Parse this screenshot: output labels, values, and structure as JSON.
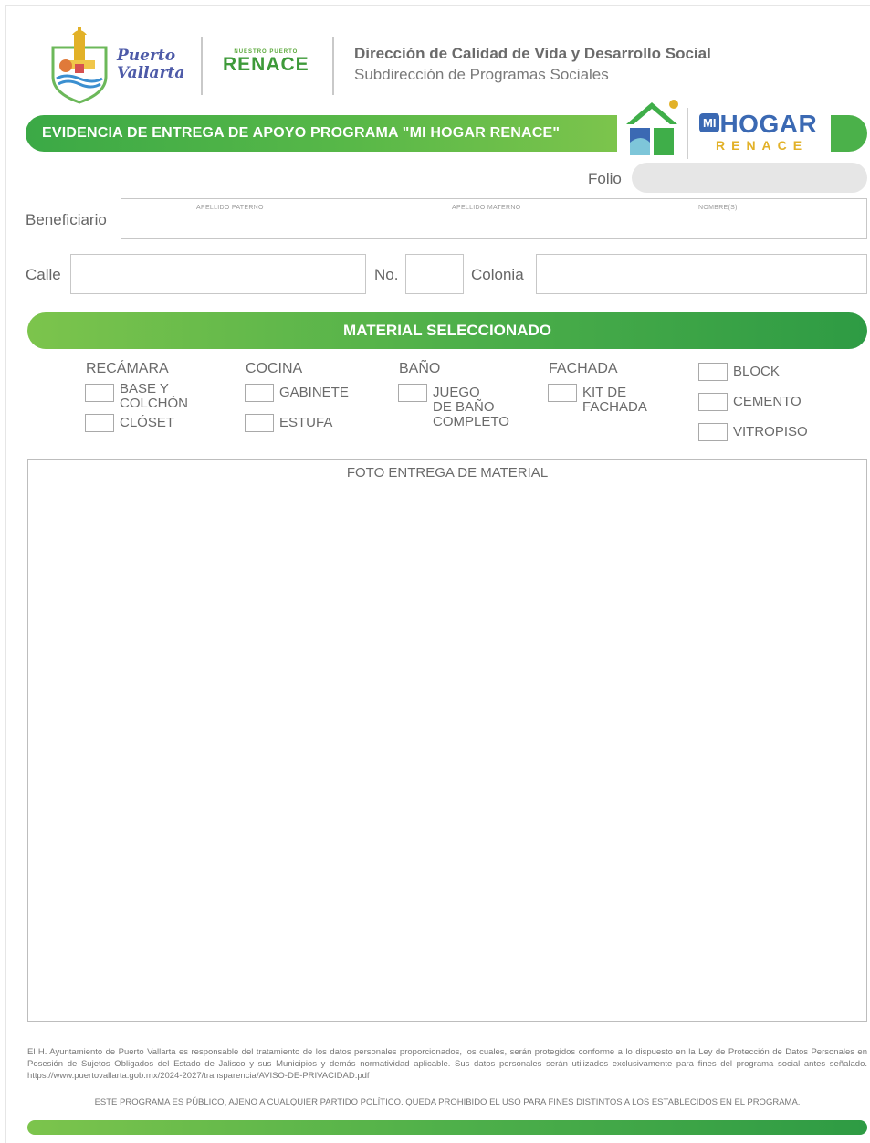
{
  "header": {
    "logo_text_line1": "Puerto",
    "logo_text_line2": "Vallarta",
    "renace_top": "NUESTRO PUERTO",
    "renace_main": "RENACE",
    "direction_title": "Dirección de Calidad de Vida y Desarrollo Social",
    "direction_subtitle": "Subdirección de Programas Sociales"
  },
  "banner": {
    "title": "EVIDENCIA DE ENTREGA DE APOYO PROGRAMA \"MI HOGAR RENACE\"",
    "logo_mi": "MI",
    "logo_hogar": "HOGAR",
    "logo_renace": "RENACE"
  },
  "form": {
    "folio_label": "Folio",
    "beneficiario_label": "Beneficiario",
    "apellido_paterno": "APELLIDO PATERNO",
    "apellido_materno": "APELLIDO MATERNO",
    "nombres": "NOMBRE(S)",
    "calle_label": "Calle",
    "no_label": "No.",
    "colonia_label": "Colonia"
  },
  "material": {
    "header": "MATERIAL SELECCIONADO",
    "recamara": {
      "title": "RECÁMARA",
      "opt1_l1": "BASE Y",
      "opt1_l2": "COLCHÓN",
      "opt2": "CLÓSET"
    },
    "cocina": {
      "title": "COCINA",
      "opt1": "GABINETE",
      "opt2": "ESTUFA"
    },
    "bano": {
      "title": "BAÑO",
      "opt1_l1": "JUEGO",
      "opt1_l2": "DE BAÑO",
      "opt1_l3": "COMPLETO"
    },
    "fachada": {
      "title": "FACHADA",
      "opt1_l1": "KIT DE",
      "opt1_l2": "FACHADA"
    },
    "otros": {
      "opt1": "BLOCK",
      "opt2": "CEMENTO",
      "opt3": "VITROPISO"
    }
  },
  "photo": {
    "label": "FOTO ENTREGA DE MATERIAL"
  },
  "footer": {
    "legal": "El H. Ayuntamiento de Puerto Vallarta es responsable del tratamiento de los datos personales proporcionados, los cuales, serán protegidos conforme a lo dispuesto en la Ley de Protección de Datos Personales en Posesión de Sujetos Obligados del Estado de Jalisco y sus Municipios y demás normatividad aplicable. Sus datos personales serán utilizados exclusivamente para fines del programa social antes señalado. https://www.puertovallarta.gob.mx/2024-2027/transparencia/AVISO-DE-PRIVACIDAD.pdf",
    "disclaimer": "ESTE  PROGRAMA ES PÚBLICO, AJENO A CUALQUIER PARTIDO POLÍTICO. QUEDA PROHIBIDO EL USO PARA FINES DISTINTOS A LOS ESTABLECIDOS EN EL PROGRAMA."
  },
  "colors": {
    "green": "#4bb14a",
    "blue": "#3b69b3",
    "gold": "#e2b128"
  }
}
